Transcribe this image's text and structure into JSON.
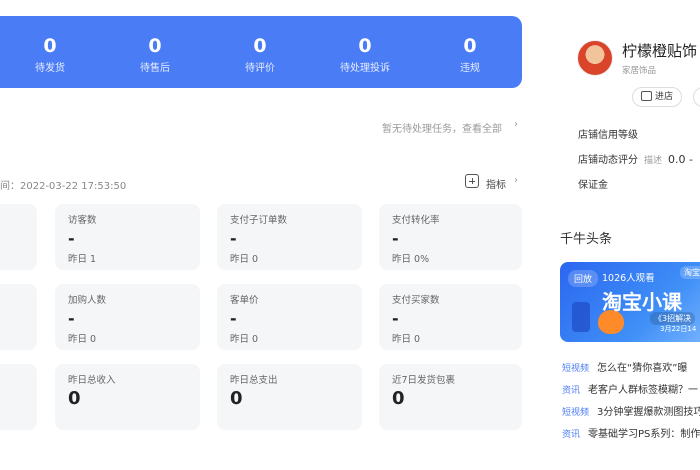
{
  "order_status": [
    {
      "value": "0",
      "label": "待发货"
    },
    {
      "value": "0",
      "label": "待售后"
    },
    {
      "value": "0",
      "label": "待评价"
    },
    {
      "value": "0",
      "label": "待处理投诉"
    },
    {
      "value": "0",
      "label": "违规"
    }
  ],
  "tasks": {
    "notice": "暂无待处理任务，查看全部",
    "chevron": "›"
  },
  "realtime": {
    "update_time": "间：2022-03-22 17:53:50",
    "metrics_label": "指标",
    "chevron": "›"
  },
  "cards_row1": [
    {
      "title": "访客数",
      "value": "-",
      "yesterday": "昨日 1"
    },
    {
      "title": "支付子订单数",
      "value": "-",
      "yesterday": "昨日 0"
    },
    {
      "title": "支付转化率",
      "value": "-",
      "yesterday": "昨日 0%"
    }
  ],
  "cards_row2": [
    {
      "title": "加购人数",
      "value": "-",
      "yesterday": "昨日 0"
    },
    {
      "title": "客单价",
      "value": "-",
      "yesterday": "昨日 0"
    },
    {
      "title": "支付买家数",
      "value": "-",
      "yesterday": "昨日 0"
    }
  ],
  "cards_row3": [
    {
      "title": "昨日总收入",
      "value": "0"
    },
    {
      "title": "昨日总支出",
      "value": "0"
    },
    {
      "title": "近7日发货包裹",
      "value": "0"
    }
  ],
  "shop": {
    "name": "柠檬橙贴饰",
    "category": "家居饰品",
    "enter_label": "进店",
    "credit_label": "店铺信用等级",
    "rating_label": "店铺动态评分",
    "rating_sub": "描述",
    "rating_value": "0.0 -",
    "deposit_label": "保证金"
  },
  "news": {
    "title": "千牛头条",
    "banner": {
      "tag": "回放",
      "watchers": "1026人观看",
      "headline": "淘宝小课",
      "sub": "《3招解决",
      "date": "3月22日14",
      "logo": "淘宝"
    },
    "items": [
      {
        "tag": "短视频",
        "text": "怎么在“猜你喜欢”曝"
      },
      {
        "tag": "资讯",
        "text": "老客户人群标签模糊？一"
      },
      {
        "tag": "短视频",
        "text": "3分钟掌握爆款测图技巧"
      },
      {
        "tag": "资讯",
        "text": "零基础学习PS系列：制作"
      }
    ]
  },
  "colors": {
    "accent": "#4a7cf6",
    "card_bg": "#f5f6f8"
  }
}
